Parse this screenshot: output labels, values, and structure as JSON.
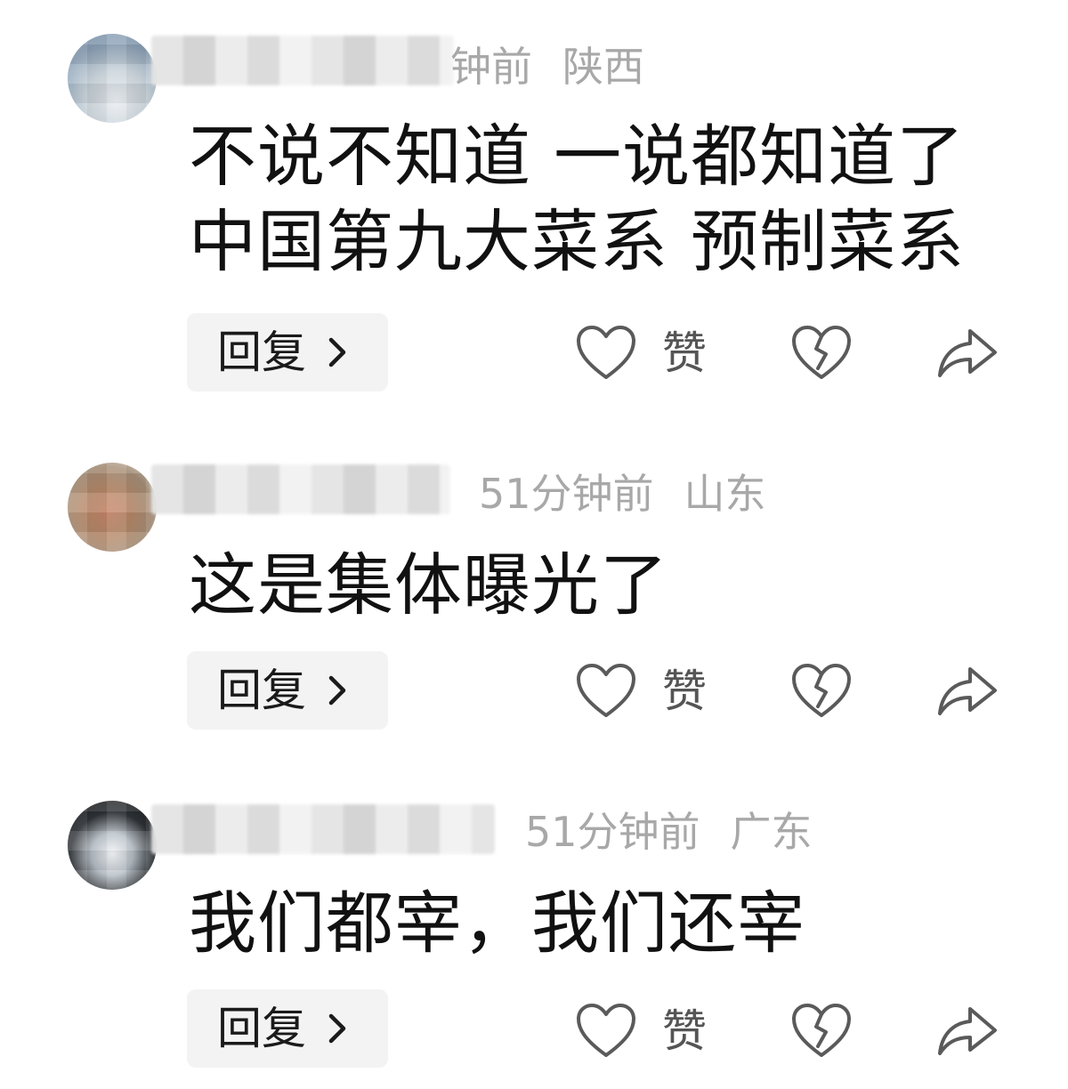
{
  "comments": [
    {
      "time": "钟前",
      "location": "陕西",
      "text": "不说不知道 一说都知道了\n中国第九大菜系 预制菜系",
      "reply_label": "回复",
      "like_label": "赞"
    },
    {
      "time": "51分钟前",
      "location": "山东",
      "text": "这是集体曝光了",
      "reply_label": "回复",
      "like_label": "赞"
    },
    {
      "time": "51分钟前",
      "location": "广东",
      "text": "我们都宰，我们还宰",
      "reply_label": "回复",
      "like_label": "赞"
    }
  ],
  "icons": {
    "like": "heart-outline-icon",
    "dislike": "broken-heart-icon",
    "share": "share-arrow-icon",
    "reply_chevron": "chevron-right-icon"
  },
  "colors": {
    "text": "#111111",
    "meta": "#a8a8a8",
    "icon": "#5a5a5a",
    "reply_bg": "#f3f3f3"
  }
}
